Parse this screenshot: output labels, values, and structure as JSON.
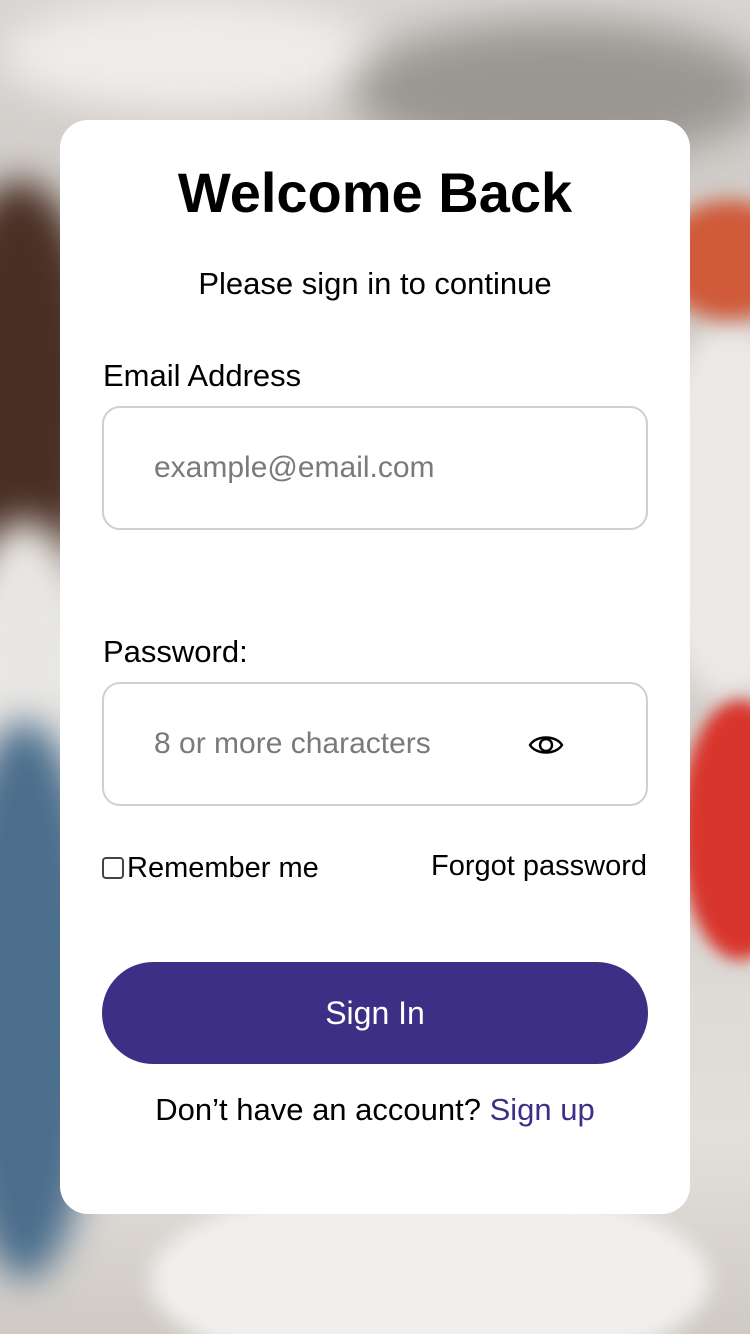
{
  "header": {
    "title": "Welcome Back",
    "subtitle": "Please sign in to continue"
  },
  "email": {
    "label": "Email Address",
    "placeholder": "example@email.com",
    "value": ""
  },
  "password": {
    "label": "Password:",
    "placeholder": "8 or more characters",
    "value": "",
    "toggle_icon": "eye-icon"
  },
  "options": {
    "remember_label": "Remember me",
    "remember_checked": false,
    "forgot_label": "Forgot password"
  },
  "actions": {
    "signin_label": "Sign In"
  },
  "footer": {
    "prompt": "Don’t have an account? ",
    "signup_label": "Sign up"
  },
  "colors": {
    "primary": "#3d2f86",
    "card_bg": "#ffffff",
    "field_border": "#cfcfcf"
  }
}
